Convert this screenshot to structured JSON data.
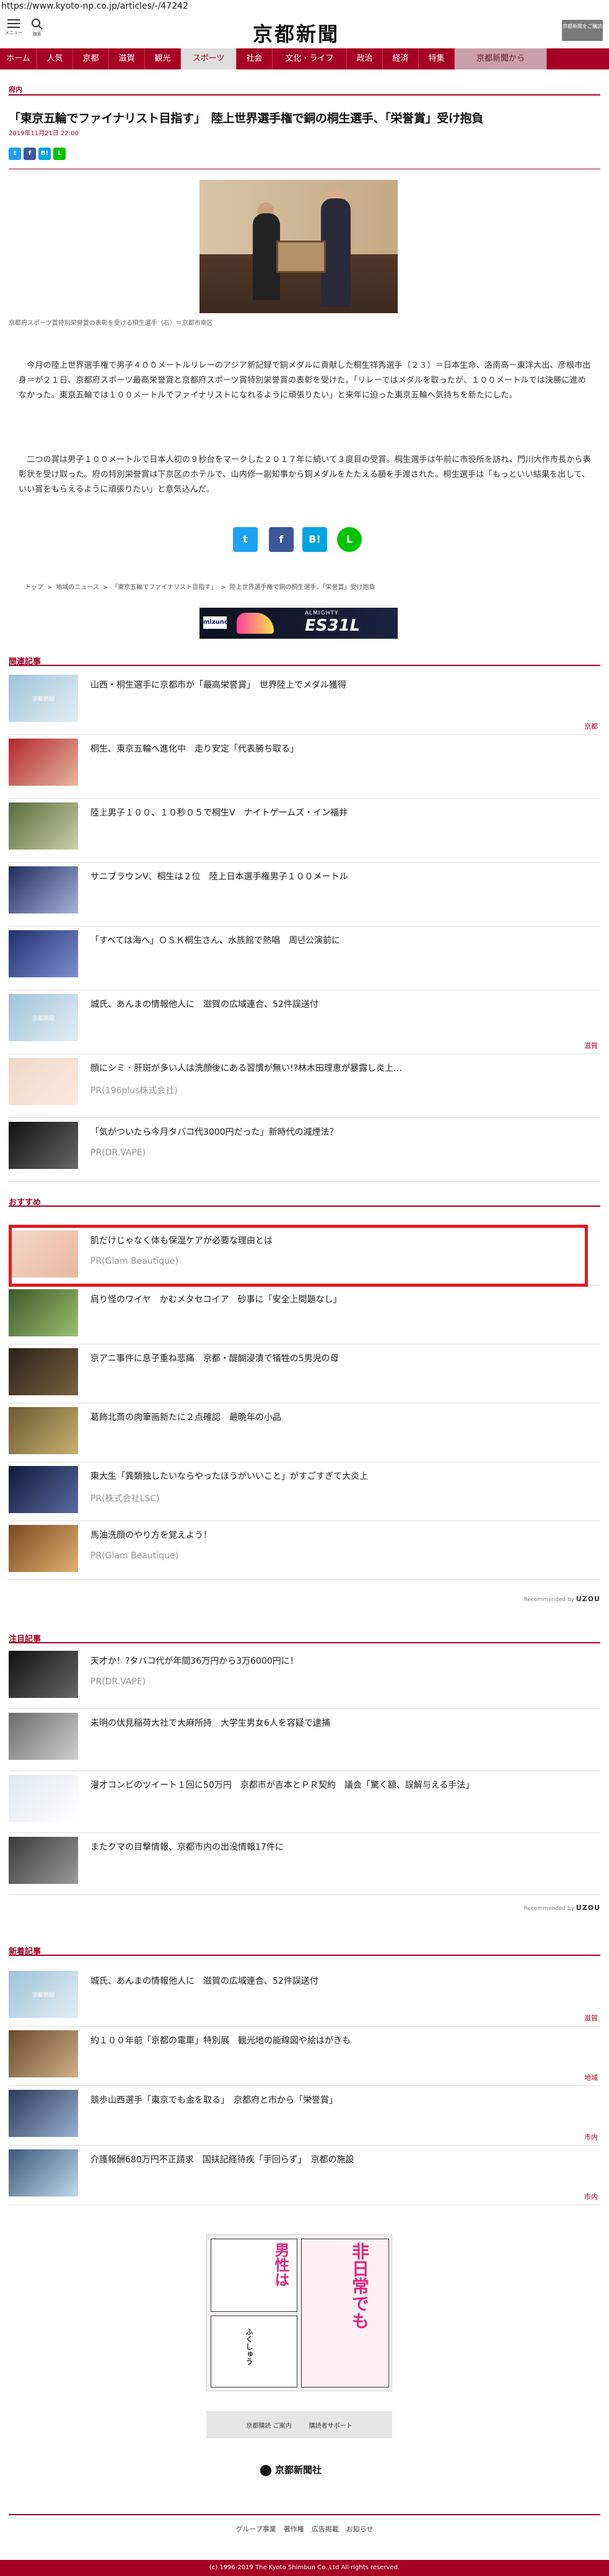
{
  "url": "https://www.kyoto-np.co.jp/articles/-/47242",
  "header": {
    "menu_label": "メニュー",
    "search_label": "検索",
    "logo": "京都新聞",
    "subscribe_label": "京都新聞をご購読"
  },
  "nav": [
    {
      "label": "ホーム",
      "w": 60
    },
    {
      "label": "人気",
      "w": 58
    },
    {
      "label": "京都",
      "w": 58
    },
    {
      "label": "滋賀",
      "w": 58
    },
    {
      "label": "観光",
      "w": 58
    },
    {
      "label": "スポーツ",
      "w": 90,
      "active": true
    },
    {
      "label": "社会",
      "w": 58
    },
    {
      "label": "文化・ライフ",
      "w": 120
    },
    {
      "label": "政治",
      "w": 58
    },
    {
      "label": "経済",
      "w": 58
    },
    {
      "label": "特集",
      "w": 58
    },
    {
      "label": "京都新聞から",
      "w": 149,
      "gray": true
    }
  ],
  "article": {
    "section": "府内",
    "title": "「東京五輪でファイナリスト目指す」　陸上世界選手権で銅の桐生選手、「栄誉賞」受け抱負",
    "date": "2019年11月21日 22:00",
    "caption": "京都府スポーツ賞特別栄誉賞の表彰を受ける桐生選手（右）＝京都市南区",
    "paragraphs": [
      "　今月の陸上世界選手権で男子４００メートルリレーのアジア新記録で銅メダルに貢献した桐生祥秀選手（２３）＝日本生命、洛南高－東洋大出、彦根市出身＝が２１日、京都府スポーツ最高栄誉賞と京都府スポーツ賞特別栄誉賞の表彰を受けた。「リレーではメダルを取ったが、１００メートルでは決勝に進めなかった。東京五輪では１００メートルでファイナリストになれるように頑張りたい」と来年に迫った東京五輪へ気持ちを新たにした。",
      "　二つの賞は男子１００メートルで日本人初の９秒台をマークした２０１７年に続いて３度目の受賞。桐生選手は午前に市役所を訪れ、門川大作市長から表彰状を受け取った。府の特別栄誉賞は下京区のホテルで、山内修一副知事から銅メダルをたたえる額を手渡された。桐生選手は「もっといい結果を出して、いい賞をもらえるように頑張りたい」と意気込んだ。"
    ]
  },
  "share": {
    "twitter": "t",
    "facebook": "f",
    "hatena": "B!",
    "line": "L"
  },
  "breadcrumb": [
    "トップ",
    ">",
    "地域のニュース",
    ">",
    "「東京五輪でファイナリスト目指す」",
    ">",
    "陸上世界選手権で銅の桐生選手、「栄誉賞」受け抱負"
  ],
  "ad_banner": {
    "maker": "mizuno",
    "brand": "ALMIGHTY",
    "model": "ES31L"
  },
  "related": {
    "title": "関連記事",
    "items": [
      {
        "title": "山西・桐生選手に京都市が「最高栄誉賞」　世界陸上でメダル獲得",
        "cat": "京都",
        "ph": "京都新聞"
      },
      {
        "title": "桐生、東京五輪へ進化中　走り安定「代表勝ち取る」",
        "cat": "",
        "ph": ""
      },
      {
        "title": "陸上男子１００、１０秒０５で桐生V　ナイトゲームズ・イン福井",
        "cat": "",
        "ph": ""
      },
      {
        "title": "サニブラウンV、桐生は２位　陸上日本選手権男子１００メートル",
        "cat": "",
        "ph": ""
      },
      {
        "title": "「すべては海へ」ＯＳＫ桐生さん、水族館で熱唱　周년公演前に",
        "cat": "",
        "ph": ""
      },
      {
        "title": "城氏、あんまの情報他人に　滋賀の広域連合、52件誤送付",
        "cat": "滋賀",
        "ph": "京都新聞"
      },
      {
        "title": "顔にシミ・肝斑が多い人は洗顔後にある習慣が無い!?林木田理恵が暴露し炎上…",
        "pr": "PR(196plus株式会社)",
        "ph": ""
      },
      {
        "title": "「気がついたら今月タバコ代3000円だった」新時代の減煙法？",
        "pr": "PR(DR.VAPE)",
        "ph": ""
      }
    ]
  },
  "recommend": {
    "title": "おすすめ",
    "items": [
      {
        "title": "肌だけじゃなく体も保湿ケアが必要な理由とは",
        "pr": "PR(Glam Beautique)"
      },
      {
        "title": "肩り怪のワイヤ　かむメタセコイア　砂事に「安全上問題なし」"
      },
      {
        "title": "京アニ事件に息子重ね悲痛　京都・醍醐浸漬で犠牲の5男児の母"
      },
      {
        "title": "葛飾北斎の肉筆画新たに２点確認　最晩年の小品"
      },
      {
        "title": "東大生「異類独したいならやったほうがいいこと」がすごすぎて大炎上",
        "pr": "PR(株式会社LSC)"
      },
      {
        "title": "馬油洗顔のやり方を覚えよう！",
        "pr": "PR(Glam Beautique)"
      }
    ],
    "recommended_by": "Recommended by",
    "uzou": "UZOU"
  },
  "attention": {
    "title": "注目記事",
    "items": [
      {
        "title": "天才か！?タバコ代が年間36万円から3万6000円に！",
        "pr": "PR(DR.VAPE)"
      },
      {
        "title": "未明の伏見稲荷大社で大麻所持　大学生男女6人を容疑で逮捕"
      },
      {
        "title": "漫才コンビのツイート１回に50万円　京都市が吉本とＰＲ契約　議会「驚く額、誤解与える手法」"
      },
      {
        "title": "またクマの目撃情報、京都市内の出没情報17件に"
      }
    ]
  },
  "latest": {
    "title": "新着記事",
    "items": [
      {
        "title": "城氏、あんまの情報他人に　滋賀の広域連合、52件誤送付",
        "cat": "滋賀",
        "ph": "京都新聞"
      },
      {
        "title": "約１００年前「京都の電車」特別展　観光地の能線図や絵はがきも",
        "cat": "地域"
      },
      {
        "title": "競歩山西選手「東京でも金を取る」　京都府と市から「栄誉賞」",
        "cat": "市内"
      },
      {
        "title": "介護報酬680万円不正請求　国扶記経待疾「手回らず」　京都の施設",
        "cat": "市内"
      }
    ]
  },
  "manga": {
    "text1": "非日常でも",
    "text2": "男性は",
    "author": "ふくしゅう"
  },
  "footer": {
    "btn1": "京都購読 ご案内",
    "btn2": "購読者サポート",
    "logo": "京都新聞社",
    "links": [
      "グループ事業",
      "著作権",
      "広告掲載",
      "お知らせ"
    ],
    "copyright": "(c) 1996-2019 The Kyoto Shimbun Co.,Ltd All rights reserved."
  },
  "colors": {
    "brand": "#a50024",
    "ad_highlight": "#e21c23",
    "twitter": "#1da1f2",
    "facebook": "#3b5998",
    "hatena": "#00a4de",
    "line": "#00c300"
  }
}
